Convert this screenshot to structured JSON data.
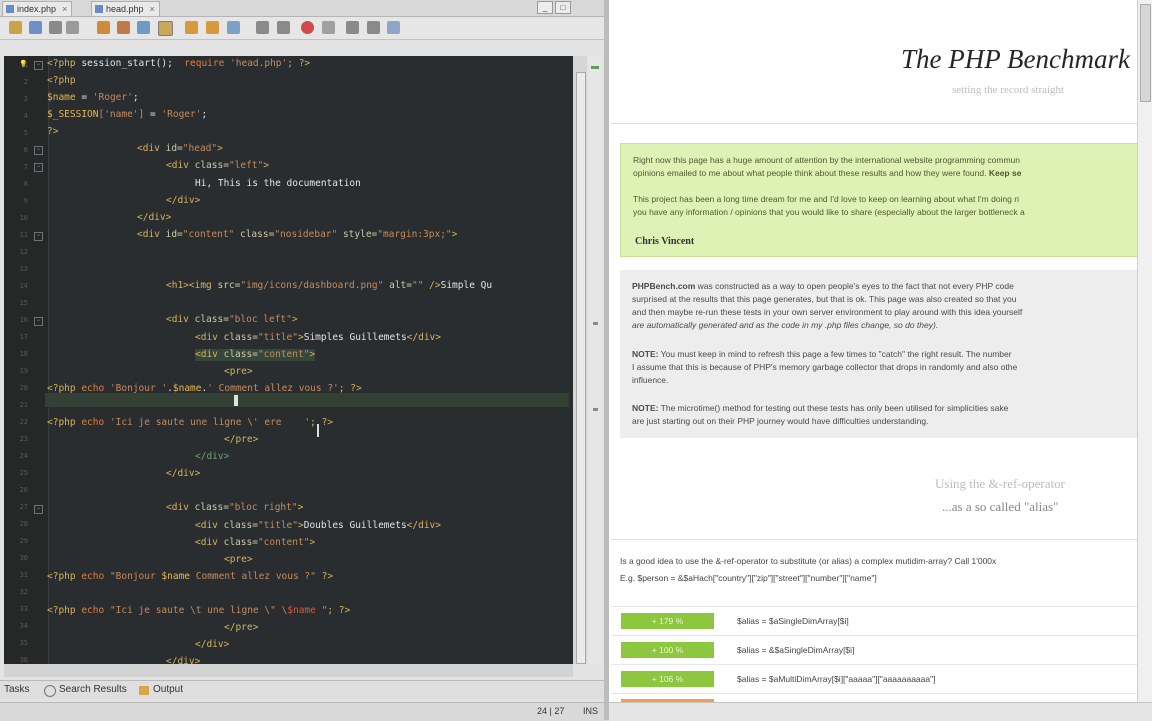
{
  "ide": {
    "tabs": [
      {
        "label": "index.php"
      },
      {
        "label": "head.php"
      }
    ],
    "close_glyph": "×",
    "window_buttons": [
      "_",
      "□"
    ],
    "toolbar_icons": [
      "new-file-icon",
      "open-project-icon",
      "save-icon",
      "undo-icon",
      "redo-icon",
      "find-icon",
      "back-icon",
      "forward-icon",
      "toggle-bookmark-icon",
      "prev-bookmark-icon",
      "next-bookmark-icon",
      "shift-left-icon",
      "shift-right-icon",
      "record-macro-icon",
      "stop-macro-icon",
      "start-macro-icon",
      "comment-icon",
      "uncomment-icon",
      "database-icon"
    ],
    "bottom_tabs": [
      {
        "label": "Tasks"
      },
      {
        "label": "Search Results"
      },
      {
        "label": "Output"
      }
    ],
    "status": {
      "position": "24 | 27",
      "mode": "INS"
    },
    "colors": {
      "editor_bg": "#2a2d2f",
      "php_tag": "#d6b35a",
      "keyword": "#e07f3c",
      "string": "#c58b5e",
      "variable": "#e8b84b"
    }
  },
  "code": {
    "line1": {
      "a": "<?php",
      "b": " session_start();  ",
      "c": "require",
      "d": " 'head.php'",
      "e": "; ?>"
    },
    "line2": "<?php",
    "line3": {
      "a": "$name",
      "b": " = ",
      "c": "'Roger'",
      "d": ";"
    },
    "line4": {
      "a": "$_SESSION",
      "b": "['name']",
      "c": " = ",
      "d": "'Roger'",
      "e": ";"
    },
    "line5": "?>",
    "line7": {
      "a": "<div ",
      "b": "id=",
      "c": "\"head\"",
      "d": ">"
    },
    "line8": {
      "a": "<div ",
      "b": "class=",
      "c": "\"left\"",
      "d": ">"
    },
    "line9": "Hi, This is the documentation",
    "line10": "</div>",
    "line11": "</div>",
    "line12": {
      "a": "<div ",
      "b": "id=",
      "c": "\"content\"",
      "d": " class=",
      "e": "\"nosidebar\"",
      "f": " style=",
      "g": "\"margin:3px;\"",
      "h": ">"
    },
    "line15": {
      "a": "<h1><img ",
      "b": "src=",
      "c": "\"img/icons/dashboard.png\"",
      "d": " alt=",
      "e": "\"\"",
      "f": " />",
      "g": "Simple Qu"
    },
    "line17": {
      "a": "<div ",
      "b": "class=",
      "c": "\"bloc left\"",
      "d": ">"
    },
    "line18": {
      "a": "<div ",
      "b": "class=",
      "c": "\"title\"",
      "d": ">",
      "e": "Simples Guillemets",
      "f": "</div>"
    },
    "line19": {
      "a": "<div ",
      "b": "class=",
      "c": "\"content\"",
      "d": ">"
    },
    "line20": "<pre>",
    "line21": {
      "a": "<?php",
      "b": " echo ",
      "c": "'Bonjour '",
      "d": ".",
      "e": "$name",
      "f": ".",
      "g": "' Comment allez vous ?'",
      "h": "; ?>"
    },
    "line23": {
      "a": "<?php",
      "b": " echo ",
      "c": "'Ici je saute une ligne \\' ere    '",
      "d": "; ?>"
    },
    "line24": "</pre>",
    "line25": "</div>",
    "line26": "</div>",
    "line28": {
      "a": "<div ",
      "b": "class=",
      "c": "\"bloc right\"",
      "d": ">"
    },
    "line29": {
      "a": "<div ",
      "b": "class=",
      "c": "\"title\"",
      "d": ">",
      "e": "Doubles Guillemets",
      "f": "</div>"
    },
    "line30": {
      "a": "<div ",
      "b": "class=",
      "c": "\"content\"",
      "d": ">"
    },
    "line31": "<pre>",
    "line32": {
      "a": "<?php",
      "b": " echo ",
      "c": "\"Bonjour ",
      "d": "$name",
      "e": " Comment allez vous ?\"",
      "f": " ?>"
    },
    "line34": {
      "a": "<?php",
      "b": " echo ",
      "c": "\"Ici je saute \\t une ligne \\\" \\",
      "d": "$name",
      "e": " \"",
      "f": "; ?>"
    },
    "line35": "</pre>",
    "line36": "</div>",
    "line37": "</div>"
  },
  "browser": {
    "title": "The PHP Benchmark",
    "subtitle": "setting the record straight",
    "intro": {
      "p1_line1": "Right now this page has a huge amount of attention by the international website programming commun",
      "p1_line2": "opinions emailed to me about what people think about these results and how they were found.",
      "p1_bold": "Keep se",
      "p2_line1": "This project has been a long time dream for me and I'd love to keep on learning about what I'm doing ri",
      "p2_line2": "you have any information / opinions that you would like to share (especially about the larger bottleneck a",
      "author": "Chris Vincent"
    },
    "about": {
      "brand": "PHPBench.com",
      "l1": "     was constructed as a way to open people's eyes to the fact that not every PHP code",
      "l2": "surprised at the results that this page generates, but that is ok. This page was also created so that you",
      "l3": "and then maybe re-run these tests in your own server environment to play around with this idea yourself",
      "l4": "are automatically generated and as the code in my .php files change, so do they).",
      "note1_label": "NOTE:",
      "note1_l1": "   You must keep in mind to refresh this page a few times to \"catch\" the right result. The number",
      "note1_l2": "I assume that this is because of PHP's memory garbage collector that drops in randomly and also othe",
      "note1_l3": "influence.",
      "note2_label": "NOTE:",
      "note2_l1": "   The microtime() method for testing out these tests has only been utilised for simplicities sake",
      "note2_l2": "are just starting out on their PHP journey would have difficulties understanding."
    },
    "section": {
      "title": "Using the &-ref-operator",
      "subtitle": "...as a so called \"alias\""
    },
    "question": {
      "l1": "Is a good idea to use the &-ref-operator to substitute (or alias) a complex mutidim-array?   Call 1'000x",
      "l2": "E.g. $person = &$aHach[\"country\"][\"zip\"][\"street\"][\"number\"][\"name\"]"
    },
    "results": [
      {
        "percent": "+ 179 %",
        "code": "$alias = $aSingleDimArray[$i]"
      },
      {
        "percent": "+ 100 %",
        "code": "$alias = &$aSingleDimArray[$i]"
      },
      {
        "percent": "+ 106 %",
        "code": "$alias = $aMultiDimArray[$i][\"aaaaa\"][\"aaaaaaaaaa\"]"
      }
    ],
    "colors": {
      "intro_bg": "#dff2b6",
      "bar_green": "#8dc63f",
      "bar_orange": "#f0a04b"
    }
  }
}
